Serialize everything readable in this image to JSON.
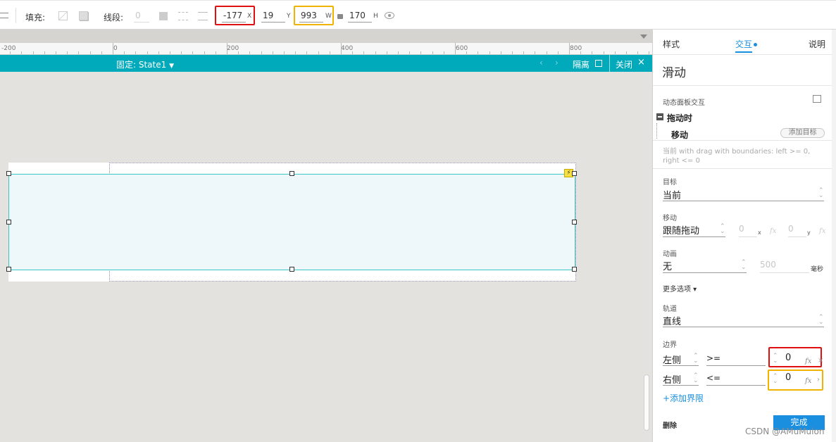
{
  "toolbar": {
    "fill_label": "填充:",
    "stroke_label": "线段:",
    "stroke_width": "0",
    "x_value": "-177",
    "x_suffix": "X",
    "y_value": "19",
    "y_suffix": "Y",
    "w_value": "993",
    "w_suffix": "W",
    "h_value": "170",
    "h_suffix": "H"
  },
  "ruler": {
    "labels": [
      "-200",
      "0",
      "200",
      "400",
      "600",
      "800"
    ]
  },
  "statebar": {
    "state_label": "固定: State1",
    "isolate_label": "隔离",
    "close_label": "关闭"
  },
  "panel": {
    "tabs": {
      "style": "样式",
      "interaction": "交互",
      "notes": "说明"
    },
    "title": "滑动",
    "dyn_panel_label": "动态面板交互",
    "event_label": "拖动时",
    "action_label": "移动",
    "add_target_label": "添加目标",
    "description_line1": "当前 with drag  with boundaries: left >= 0,",
    "description_line2": "right <= 0",
    "target_label": "目标",
    "target_value": "当前",
    "move_label": "移动",
    "move_value": "跟随拖动",
    "move_x_value": "0",
    "move_x_suffix": "x",
    "move_y_value": "0",
    "move_y_suffix": "y",
    "anim_label": "动画",
    "anim_value": "无",
    "anim_ms_value": "500",
    "anim_ms_unit": "毫秒",
    "more_options_label": "更多选项 ▾",
    "track_label": "轨道",
    "track_value": "直线",
    "boundary_label": "边界",
    "left_side_label": "左侧",
    "left_op": ">=",
    "left_value": "0",
    "right_side_label": "右侧",
    "right_op": "<=",
    "right_value": "0",
    "add_boundary_label": "+添加界限",
    "delete_label": "删除",
    "done_label": "完成",
    "fx_glyph": "fx"
  },
  "watermark": "CSDN @AMuMulon",
  "colors": {
    "accent": "#00aabb",
    "done_button": "#1a8fe0",
    "highlight_red": "#e01010",
    "highlight_orange": "#f0b400",
    "interaction_tab": "#1a8fe0"
  }
}
